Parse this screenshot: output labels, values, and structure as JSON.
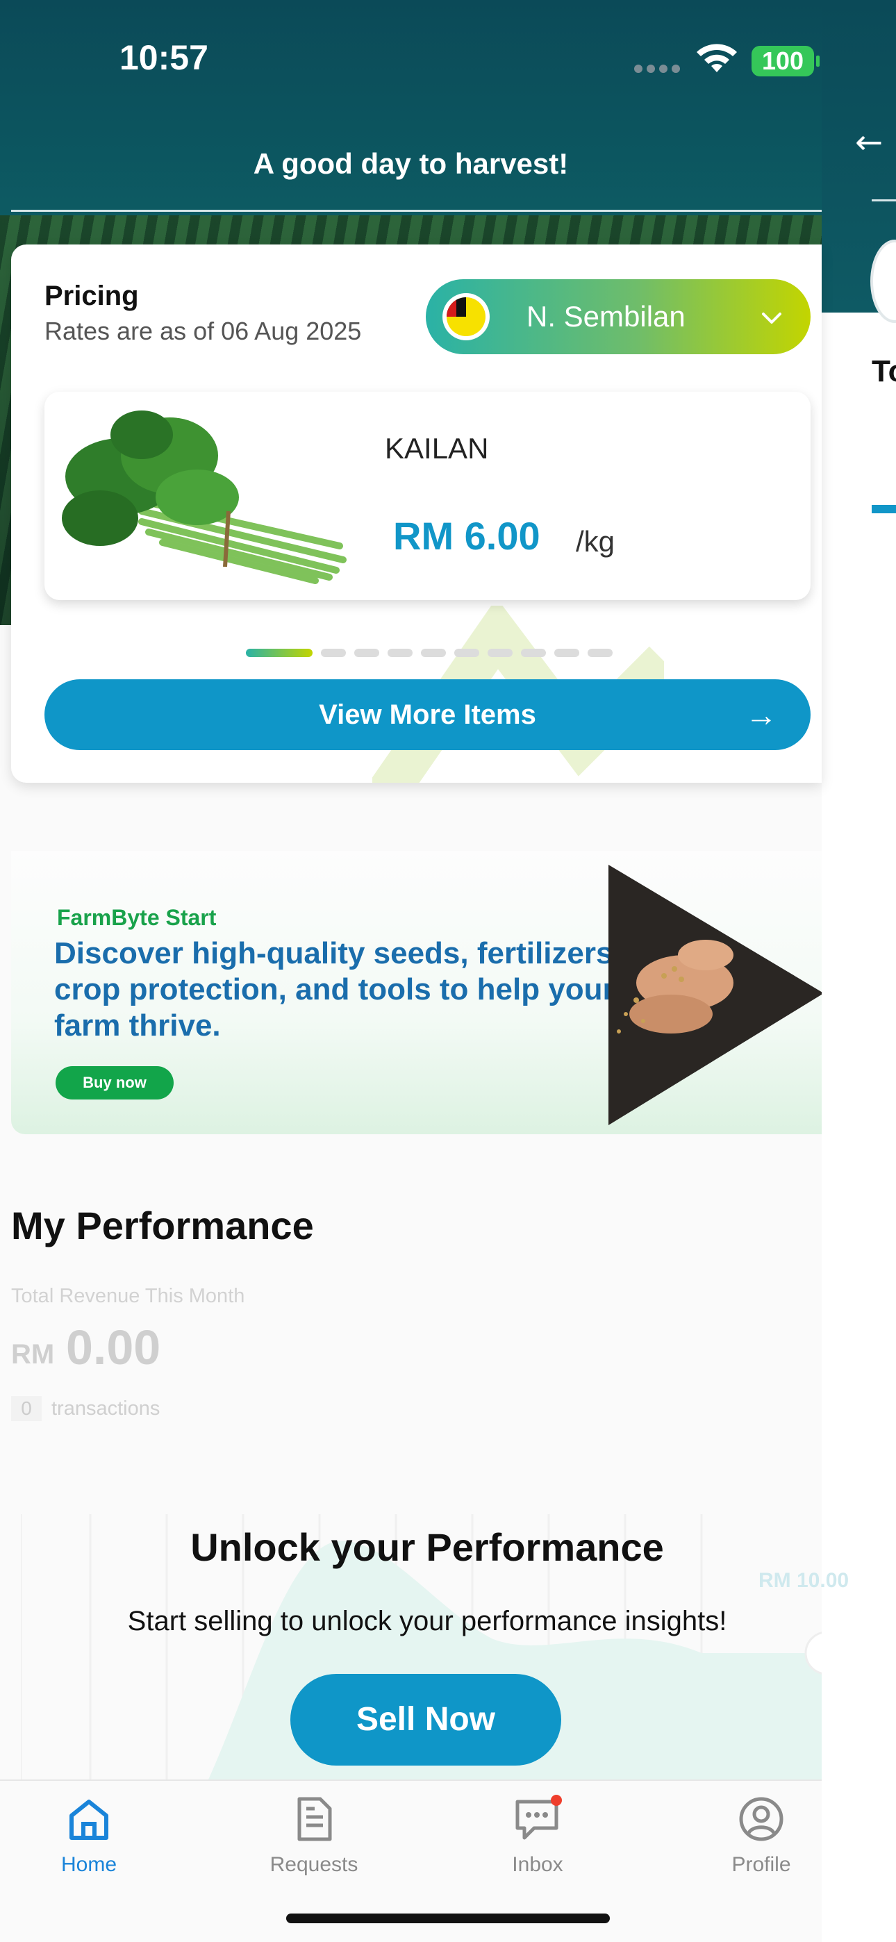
{
  "status_bar": {
    "time": "10:57",
    "battery": "100"
  },
  "header": {
    "greeting": "A good day to harvest!"
  },
  "pricing": {
    "title": "Pricing",
    "subtitle": "Rates are as of 06 Aug 2025",
    "region": "N. Sembilan",
    "item": {
      "name": "KAILAN",
      "price": "RM 6.00",
      "unit": "/kg"
    },
    "carousel": {
      "total": 10,
      "active_index": 0
    },
    "view_more_label": "View More Items"
  },
  "promo": {
    "brand": "FarmByte Start",
    "headline": "Discover high-quality seeds, fertilizers, crop protection, and tools to help your farm thrive.",
    "button": "Buy now"
  },
  "performance": {
    "title": "My Performance",
    "revenue_label": "Total Revenue This Month",
    "currency": "RM",
    "revenue_value": "0.00",
    "transactions_count": "0",
    "transactions_label": "transactions",
    "unlock_title": "Unlock your Performance",
    "unlock_subtitle": "Start selling to unlock your performance insights!",
    "chart_label": "RM 10.00",
    "sell_button": "Sell Now"
  },
  "tabs": [
    {
      "label": "Home",
      "icon": "home-icon",
      "active": true
    },
    {
      "label": "Requests",
      "icon": "document-icon",
      "active": false
    },
    {
      "label": "Inbox",
      "icon": "chat-icon",
      "active": false,
      "badge": true
    },
    {
      "label": "Profile",
      "icon": "profile-icon",
      "active": false
    }
  ],
  "colors": {
    "accent": "#0f96c8",
    "header_bg": "#0b4a58",
    "green": "#12a54a",
    "tab_active": "#1a84d9"
  }
}
